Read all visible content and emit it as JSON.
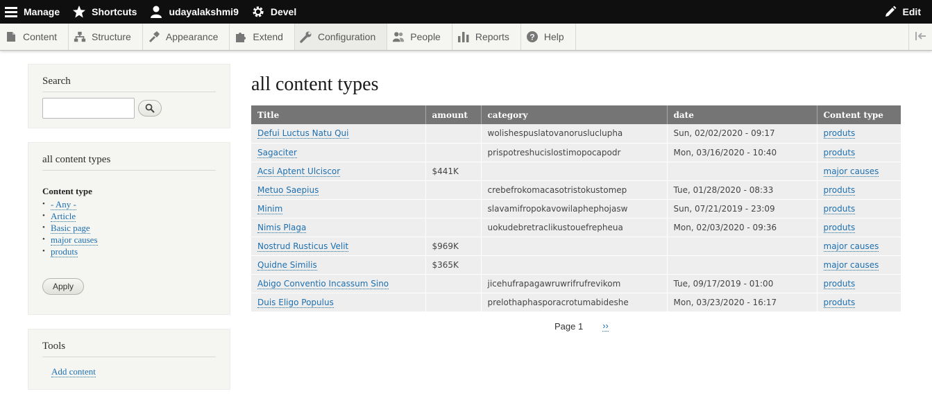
{
  "toolbar": {
    "manage": "Manage",
    "shortcuts": "Shortcuts",
    "user": "udayalakshmi9",
    "devel": "Devel",
    "edit": "Edit"
  },
  "tray": {
    "items": [
      {
        "label": "Content",
        "icon": "file-icon"
      },
      {
        "label": "Structure",
        "icon": "sitemap-icon"
      },
      {
        "label": "Appearance",
        "icon": "brush-icon"
      },
      {
        "label": "Extend",
        "icon": "puzzle-icon"
      },
      {
        "label": "Configuration",
        "icon": "wrench-icon"
      },
      {
        "label": "People",
        "icon": "people-icon"
      },
      {
        "label": "Reports",
        "icon": "bar-chart-icon"
      },
      {
        "label": "Help",
        "icon": "help-icon"
      }
    ]
  },
  "sidebar": {
    "search": {
      "title": "Search",
      "placeholder": ""
    },
    "filter": {
      "title": "all content types",
      "label": "Content type",
      "options": [
        "- Any -",
        "Article",
        "Basic page",
        "major causes",
        "produts"
      ],
      "apply": "Apply"
    },
    "tools": {
      "title": "Tools",
      "link": "Add content"
    }
  },
  "main": {
    "title": "all content types",
    "columns": [
      "Title",
      "amount",
      "category",
      "date",
      "Content type"
    ],
    "rows": [
      [
        "Defui Luctus Natu Qui",
        "",
        "wolishespuslatovanorusluclupha",
        "Sun, 02/02/2020 - 09:17",
        "produts"
      ],
      [
        "Sagaciter",
        "",
        "prispotreshucislostimopocapodr",
        "Mon, 03/16/2020 - 10:40",
        "produts"
      ],
      [
        "Acsi Aptent Ulciscor",
        "$441K",
        "",
        "",
        "major causes"
      ],
      [
        "Metuo Saepius",
        "",
        "crebefrokomacasotristokustomep",
        "Tue, 01/28/2020 - 08:33",
        "produts"
      ],
      [
        "Minim",
        "",
        "slavamifropokavowilaphephojasw",
        "Sun, 07/21/2019 - 23:09",
        "produts"
      ],
      [
        "Nimis Plaga",
        "",
        "uokudebretraclikustouefrepheua",
        "Mon, 02/03/2020 - 09:36",
        "produts"
      ],
      [
        "Nostrud Rusticus Velit",
        "$969K",
        "",
        "",
        "major causes"
      ],
      [
        "Quidne Similis",
        "$365K",
        "",
        "",
        "major causes"
      ],
      [
        "Abigo Conventio Incassum Sino",
        "",
        "jicehufrapagawruwrifrufrevikom",
        "Tue, 09/17/2019 - 01:00",
        "produts"
      ],
      [
        "Duis Eligo Populus",
        "",
        "prelothaphasporacrotumabideshe",
        "Mon, 03/23/2020 - 16:17",
        "produts"
      ]
    ],
    "pager": {
      "current": "Page 1",
      "next": "››"
    }
  },
  "colors": {
    "toolbar_bg": "#0f0f0f",
    "tray_bg": "#f5f5f2",
    "link": "#1d6fb0",
    "table_header": "#757575",
    "table_row": "#eeeeee"
  }
}
